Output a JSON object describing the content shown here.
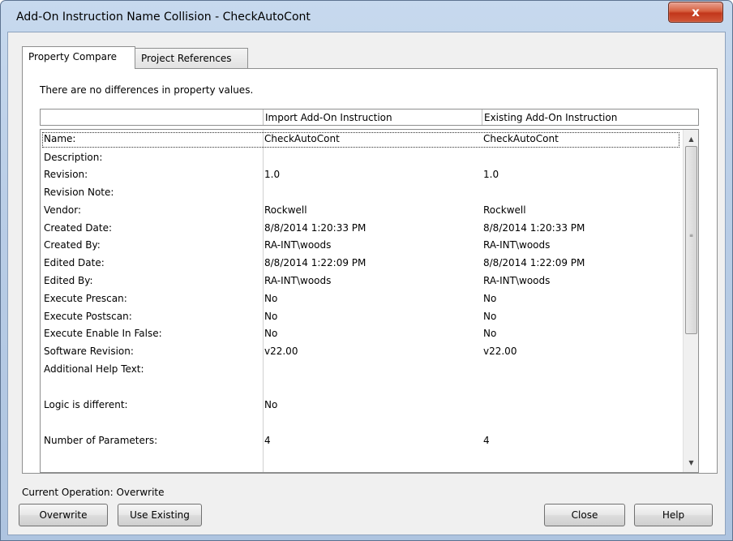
{
  "window": {
    "title": "Add-On Instruction Name Collision - CheckAutoCont",
    "close_glyph": "x"
  },
  "tabs": [
    {
      "label": "Property Compare",
      "active": true
    },
    {
      "label": "Project References",
      "active": false
    }
  ],
  "panel": {
    "message": "There are no differences in property values.",
    "columns": [
      "",
      "Import Add-On Instruction",
      "Existing Add-On Instruction"
    ],
    "rows": [
      {
        "property": "Name:",
        "import": "CheckAutoCont",
        "existing": "CheckAutoCont"
      },
      {
        "property": "Description:",
        "import": "",
        "existing": ""
      },
      {
        "property": "Revision:",
        "import": "1.0",
        "existing": "1.0"
      },
      {
        "property": "Revision Note:",
        "import": "",
        "existing": ""
      },
      {
        "property": "Vendor:",
        "import": "Rockwell",
        "existing": "Rockwell"
      },
      {
        "property": "Created Date:",
        "import": "8/8/2014  1:20:33 PM",
        "existing": "8/8/2014  1:20:33 PM"
      },
      {
        "property": "Created By:",
        "import": "RA-INT\\woods",
        "existing": "RA-INT\\woods"
      },
      {
        "property": "Edited Date:",
        "import": "8/8/2014  1:22:09 PM",
        "existing": "8/8/2014  1:22:09 PM"
      },
      {
        "property": "Edited By:",
        "import": "RA-INT\\woods",
        "existing": "RA-INT\\woods"
      },
      {
        "property": "Execute Prescan:",
        "import": "No",
        "existing": "No"
      },
      {
        "property": "Execute Postscan:",
        "import": "No",
        "existing": "No"
      },
      {
        "property": "Execute Enable In False:",
        "import": "No",
        "existing": "No"
      },
      {
        "property": "Software Revision:",
        "import": "v22.00",
        "existing": "v22.00"
      },
      {
        "property": "Additional Help Text:",
        "import": "",
        "existing": ""
      },
      {
        "property": "Logic is different:",
        "import": "No",
        "existing": ""
      },
      {
        "property": "Number of Parameters:",
        "import": "4",
        "existing": "4"
      }
    ],
    "selected_row": "Name:"
  },
  "status": {
    "current_operation": "Current Operation: Overwrite"
  },
  "buttons": {
    "overwrite": "Overwrite",
    "use_existing": "Use Existing",
    "close": "Close",
    "help": "Help"
  },
  "icons": {
    "scroll_up": "scroll-up-arrow-icon",
    "scroll_down": "scroll-down-arrow-icon",
    "close": "close-icon"
  }
}
